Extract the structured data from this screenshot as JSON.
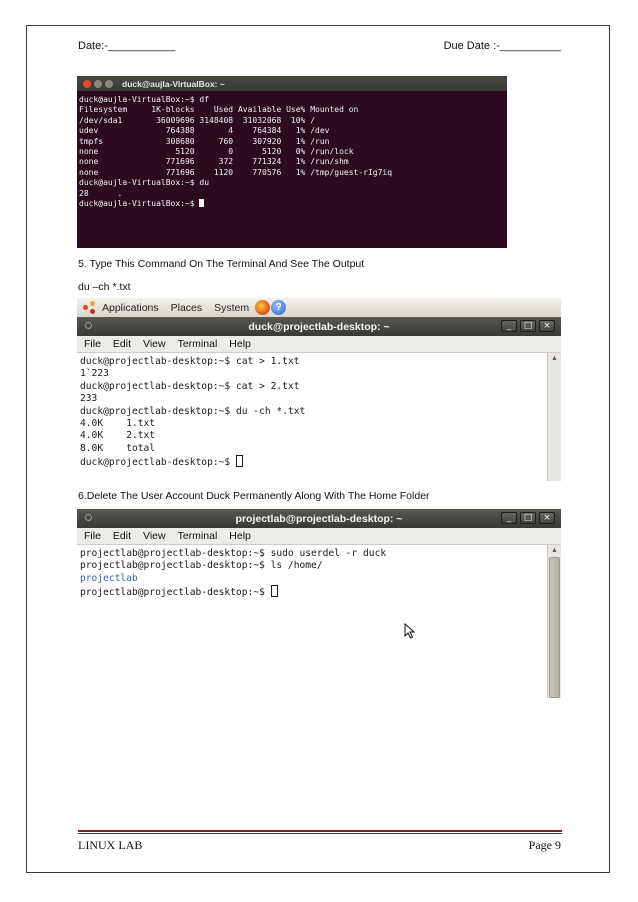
{
  "header": {
    "date_label": "Date:-___________",
    "due_date_label": "Due Date :-__________"
  },
  "terminal1": {
    "title": "duck@aujla-VirtualBox: ~",
    "lines": [
      "duck@aujla-VirtualBox:~$ df",
      "Filesystem     1K-blocks    Used Available Use% Mounted on",
      "/dev/sda1       36009696 3148408  31032068  10% /",
      "udev              764388       4    764384   1% /dev",
      "tmpfs             308680     760    307920   1% /run",
      "none                5120       0      5120   0% /run/lock",
      "none              771696     372    771324   1% /run/shm",
      "none              771696    1120    770576   1% /tmp/guest-rIg7iq",
      "duck@aujla-VirtualBox:~$ du",
      "28      .",
      "duck@aujla-VirtualBox:~$ "
    ]
  },
  "caption5": "5. Type This Command On The  Terminal And See The Output",
  "command5": "du –ch *.txt",
  "panel": {
    "applications": "Applications",
    "places": "Places",
    "system": "System"
  },
  "terminal2": {
    "title": "duck@projectlab-desktop: ~",
    "menu": [
      "File",
      "Edit",
      "View",
      "Terminal",
      "Help"
    ],
    "lines": [
      "duck@projectlab-desktop:~$ cat > 1.txt",
      "1`223",
      "duck@projectlab-desktop:~$ cat > 2.txt",
      "233",
      "duck@projectlab-desktop:~$ du -ch *.txt",
      "4.0K    1.txt",
      "4.0K    2.txt",
      "8.0K    total"
    ],
    "prompt": "duck@projectlab-desktop:~$ "
  },
  "caption6": "6.Delete The User Account Duck Permanently Along With The Home Folder",
  "terminal3": {
    "title": "projectlab@projectlab-desktop: ~",
    "menu": [
      "File",
      "Edit",
      "View",
      "Terminal",
      "Help"
    ],
    "line1": "projectlab@projectlab-desktop:~$ sudo userdel -r duck",
    "line2": "projectlab@projectlab-desktop:~$ ls /home/",
    "dir": "projectlab",
    "prompt": "projectlab@projectlab-desktop:~$ "
  },
  "footer": {
    "left": "LINUX LAB",
    "right": "Page 9"
  },
  "colors": {
    "ubuntu_terminal_bg": "#2c0a1f",
    "footer_rule": "#7a2418",
    "directory_blue": "#3465a4"
  }
}
